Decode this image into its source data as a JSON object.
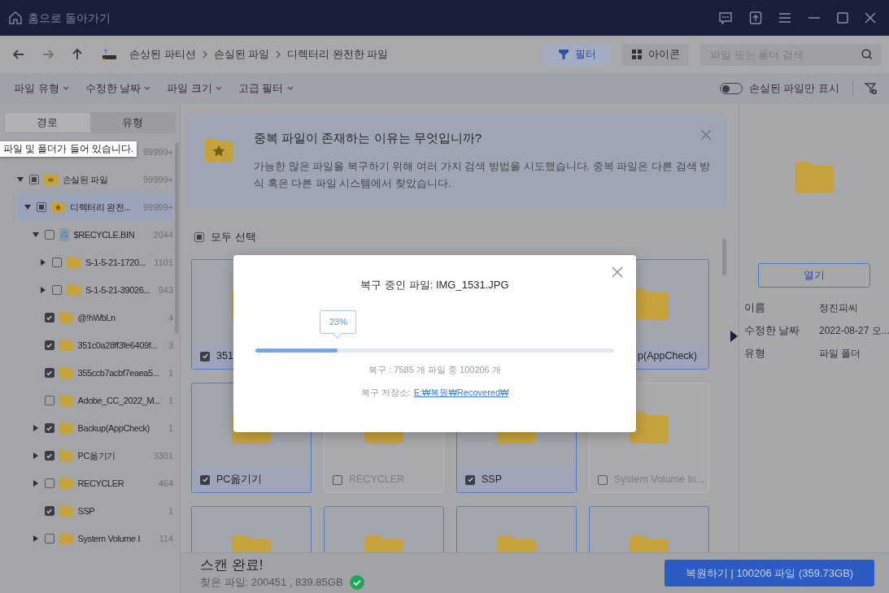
{
  "titlebar": {
    "home_label": "홈으로 돌아가기"
  },
  "toolbar": {
    "breadcrumbs": [
      "손상된 파티션",
      "손실된 파일",
      "디렉터리 완전한 파일"
    ],
    "view_buttons": [
      {
        "label": "필터",
        "kind": "filter",
        "selected": true
      },
      {
        "label": "아이콘",
        "kind": "grid",
        "selected": false
      }
    ],
    "search": {
      "placeholder": "파일 또는 폴더 검색"
    }
  },
  "filters": {
    "dropdowns": [
      "파일 유형",
      "수정한 날짜",
      "파일 크기",
      "고급 필터"
    ],
    "toggle": {
      "label": "손실된 파일만 표시",
      "on": false
    }
  },
  "sidebar": {
    "tabs": [
      {
        "label": "경로",
        "selected": true
      },
      {
        "label": "유형",
        "selected": false
      }
    ],
    "tooltip": "파일 및 폴더가 들어 있습니다.",
    "tree": [
      {
        "count": "99999+",
        "children": [
          {
            "name": "손실된 파일",
            "count": "99999+",
            "kind": "lost",
            "mixed": true,
            "expanded": true,
            "selected": false,
            "children": [
              {
                "name": "디렉터리 완전...",
                "count": "99999+",
                "kind": "star",
                "mixed": true,
                "expanded": true,
                "selected": true,
                "children": [
                  {
                    "name": "$RECYCLE.BIN",
                    "count": "2044",
                    "kind": "recycle",
                    "checked": false,
                    "expanded": true,
                    "selected": false,
                    "children": [
                      {
                        "name": "S-1-5-21-1720...",
                        "count": "1101",
                        "kind": "folder",
                        "checked": false,
                        "expanded": false,
                        "selected": false
                      },
                      {
                        "name": "S-1-5-21-39026...",
                        "count": "943",
                        "kind": "folder",
                        "checked": false,
                        "expanded": false,
                        "selected": false
                      }
                    ]
                  },
                  {
                    "name": "@!hWbLn",
                    "count": "4",
                    "kind": "folder",
                    "checked": true,
                    "selected": false
                  },
                  {
                    "name": "351c0a28ff3fe6409f...",
                    "count": "3",
                    "kind": "folder",
                    "checked": true,
                    "selected": false
                  },
                  {
                    "name": "355ccb7acbf7eaea5...",
                    "count": "1",
                    "kind": "folder",
                    "checked": true,
                    "selected": false
                  },
                  {
                    "name": "Adobe_CC_2022_M...",
                    "count": "1",
                    "kind": "folder",
                    "checked": false,
                    "selected": false
                  },
                  {
                    "name": "Backup(AppCheck)",
                    "count": "1",
                    "kind": "folder",
                    "checked": true,
                    "expanded": false,
                    "selected": false
                  },
                  {
                    "name": "PC옮기기",
                    "count": "3301",
                    "kind": "folder",
                    "checked": true,
                    "expanded": false,
                    "selected": false
                  },
                  {
                    "name": "RECYCLER",
                    "count": "464",
                    "kind": "folder",
                    "checked": false,
                    "expanded": false,
                    "selected": false
                  },
                  {
                    "name": "SSP",
                    "count": "1",
                    "kind": "folder",
                    "checked": true,
                    "selected": false
                  },
                  {
                    "name": "System Volume I",
                    "count": "114",
                    "kind": "folder",
                    "checked": false,
                    "expanded": false,
                    "selected": false
                  }
                ]
              }
            ]
          }
        ]
      }
    ]
  },
  "banner": {
    "title": "중복 파일이 존재하는 이유는 무엇입니까?",
    "text": "가능한 많은 파일을 복구하기 위해 여러 가지 검색 방법을 시도했습니다. 중복 파일은 다른 검색 방식 혹은 다른 파일 시스템에서 찾았습니다."
  },
  "select_all": {
    "label": "모두 선택",
    "mixed": true
  },
  "grid": [
    [
      {
        "kind": "folder",
        "label": "351",
        "checked": true,
        "selected": true
      },
      {
        "kind": "covered"
      },
      {
        "kind": "covered"
      },
      {
        "kind": "folder",
        "label": "p(AppCheck)",
        "selected": true
      }
    ],
    [
      {
        "kind": "folder",
        "label": "PC옮기기",
        "checked": true,
        "selected": true
      },
      {
        "kind": "folder",
        "label": "RECYCLER",
        "checked": false,
        "selected": false
      },
      {
        "kind": "folder",
        "label": "SSP",
        "checked": true,
        "selected": true
      },
      {
        "kind": "folder",
        "label": "System Volume In...",
        "checked": false,
        "selected": false
      }
    ],
    [
      {
        "kind": "folder",
        "selected": true
      },
      {
        "kind": "folder",
        "selected": true
      },
      {
        "kind": "folder",
        "selected": true
      },
      {
        "kind": "folder",
        "selected": true
      }
    ]
  ],
  "details": {
    "open_button": "열기",
    "properties": [
      {
        "label": "이름",
        "value": "정진피씨"
      },
      {
        "label": "수정한 날짜",
        "value": "2022-08-27 오..."
      },
      {
        "label": "유형",
        "value": "파일 폴더"
      }
    ]
  },
  "footer": {
    "status": "스캔 완료!",
    "found": "찾은 파일: 200451 , 839.85GB",
    "recover_button": "복원하기 | 100206 파일 (359.73GB)"
  },
  "dialog": {
    "title": "복구 중인 파일: IMG_1531.JPG",
    "percent": "23%",
    "level": 0.23,
    "progress_text": "복구 : 7585 개 파일 중 100206 개",
    "location_label": "복구 저장소:",
    "location_path": "E:₩복원₩Recovered₩"
  }
}
